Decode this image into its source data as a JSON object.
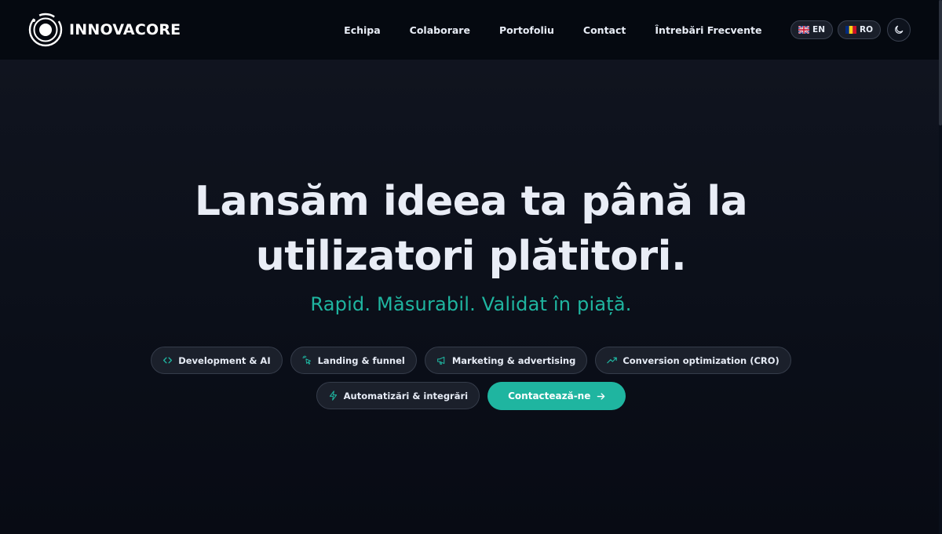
{
  "brand": {
    "name": "INNOVACORE",
    "logo_icon": "orbit-ring-icon"
  },
  "nav": {
    "items": [
      {
        "label": "Echipa"
      },
      {
        "label": "Colaborare"
      },
      {
        "label": "Portofoliu"
      },
      {
        "label": "Contact"
      },
      {
        "label": "Întrebări Frecvente"
      }
    ]
  },
  "languages": [
    {
      "code": "EN",
      "flag": "uk-flag-icon"
    },
    {
      "code": "RO",
      "flag": "ro-flag-icon"
    }
  ],
  "theme_toggle": {
    "icon": "moon-icon"
  },
  "hero": {
    "title_line1": "Lansăm ideea ta până la",
    "title_line2": "utilizatori plătitori.",
    "subtitle": "Rapid. Măsurabil. Validat în piață."
  },
  "services": [
    {
      "label": "Development & AI",
      "icon": "code-icon"
    },
    {
      "label": "Landing & funnel",
      "icon": "cursor-click-icon"
    },
    {
      "label": "Marketing & advertising",
      "icon": "megaphone-icon"
    },
    {
      "label": "Conversion optimization (CRO)",
      "icon": "trending-up-icon"
    },
    {
      "label": "Automatizări & integrări",
      "icon": "lightning-icon"
    }
  ],
  "cta": {
    "label": "Contactează-ne",
    "icon": "arrow-right-icon"
  },
  "colors": {
    "accent": "#1fb5a0",
    "header_bg": "#050910",
    "page_bg": "#0a0f1a",
    "chip_bg": "#1b202b",
    "text": "#e9edf6"
  }
}
